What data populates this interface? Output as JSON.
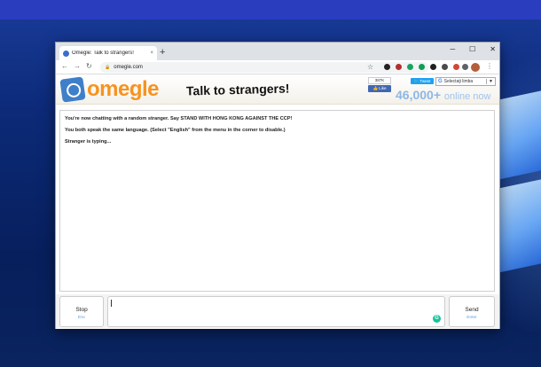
{
  "browser": {
    "tab_title": "Omegle: Talk to strangers!",
    "tab_close": "×",
    "new_tab": "+",
    "controls": {
      "minimize": "─",
      "maximize": "☐",
      "close": "✕"
    },
    "nav": {
      "back": "←",
      "forward": "→",
      "reload": "↻"
    },
    "url": "omegle.com",
    "lock_icon": "🔒",
    "star_icon": "☆",
    "menu_icon": "⋮",
    "extension_colors": [
      "#222222",
      "#b03030",
      "#1aa260",
      "#0f9d58",
      "#202020",
      "#4a4a4a",
      "#d0473a",
      "#5f6368"
    ]
  },
  "header": {
    "logo_text": "omegle",
    "tagline": "Talk to strangers!",
    "like_count": "387K",
    "like_label": "👍 Like",
    "tweet_label": "🐦 Tweet",
    "language_label": "Selectaţi limba",
    "language_icon": "G",
    "language_arrow": "▼",
    "online_count": "46,000+",
    "online_label": "online now"
  },
  "chat": {
    "lines": [
      "You're now chatting with a random stranger. Say STAND WITH HONG KONG AGAINST THE CCP!",
      "You both speak the same language. (Select \"English\" from the menu in the corner to disable.)",
      "Stranger is typing..."
    ]
  },
  "controls": {
    "stop_label": "Stop",
    "stop_hint": "Esc",
    "send_label": "Send",
    "send_hint": "Enter",
    "grammarly_icon": "G"
  },
  "colors": {
    "logo_orange": "#f7931e",
    "logo_blue": "#3f7fc9",
    "online_blue": "#8db7e6",
    "facebook": "#4267b2",
    "twitter": "#1da1f2"
  }
}
